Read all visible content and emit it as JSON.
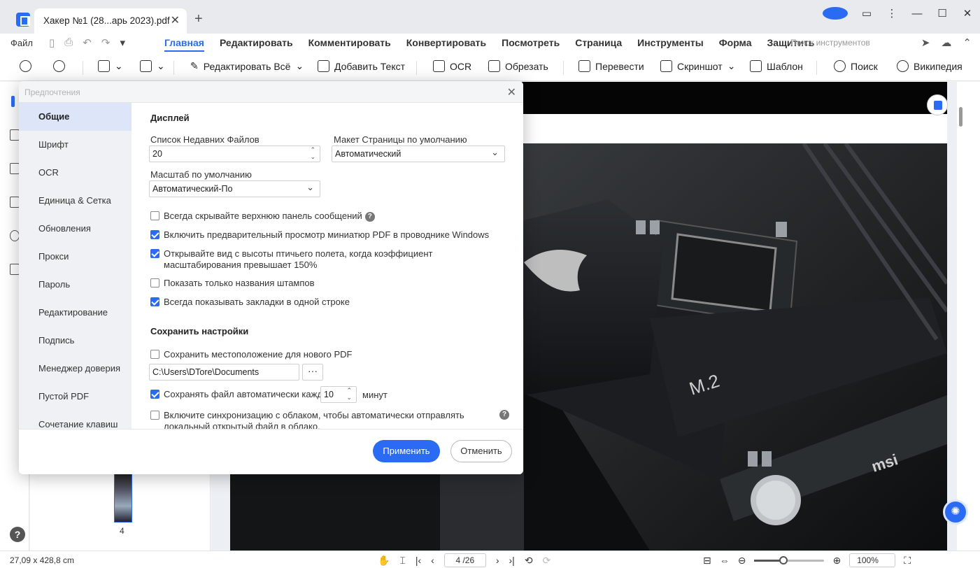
{
  "titlebar": {
    "tab_title": "Хакер №1 (28...арь 2023).pdf",
    "tab_close": "✕",
    "new_tab": "+"
  },
  "menubar": {
    "file": "Файл",
    "items": [
      "Главная",
      "Редактировать",
      "Комментировать",
      "Конвертировать",
      "Посмотреть",
      "Страница",
      "Инструменты",
      "Форма",
      "Защитить"
    ],
    "active": "Главная",
    "tool_search_placeholder": "Поиск инструментов"
  },
  "toolbar": {
    "edit_all": "Редактировать Всё",
    "add_text": "Добавить Текст",
    "ocr": "OCR",
    "crop": "Обрезать",
    "translate": "Перевести",
    "screenshot": "Скриншот",
    "template": "Шаблон",
    "search": "Поиск",
    "wikipedia": "Википедия"
  },
  "thumbnails": {
    "page_label": "4"
  },
  "status": {
    "dimensions": "27,09 x 428,8 cm",
    "page_input": "4 /26",
    "zoom_value": "100%",
    "zoom_level": 0.42
  },
  "dialog": {
    "title": "Предпочтения",
    "close": "✕",
    "sidebar": [
      {
        "label": "Общие",
        "active": true
      },
      {
        "label": "Шрифт"
      },
      {
        "label": "OCR"
      },
      {
        "label": "Единица & Сетка"
      },
      {
        "label": "Обновления"
      },
      {
        "label": "Прокси"
      },
      {
        "label": "Пароль"
      },
      {
        "label": "Редактирование"
      },
      {
        "label": "Подпись"
      },
      {
        "label": "Менеджер доверия"
      },
      {
        "label": "Пустой PDF"
      },
      {
        "label": "Сочетание клавиш"
      }
    ],
    "display": {
      "section": "Дисплей",
      "recent_files_label": "Список Недавних Файлов",
      "recent_files_value": "20",
      "page_layout_label": "Макет Страницы по умолчанию",
      "page_layout_value": "Автоматический",
      "zoom_label": "Масштаб по умолчанию",
      "zoom_value": "Автоматический-По",
      "checkboxes": [
        {
          "label": "Всегда скрывайте верхнюю панель сообщений",
          "checked": false,
          "help": true
        },
        {
          "label": "Включить предварительный просмотр миниатюр PDF в проводнике Windows",
          "checked": true
        },
        {
          "label": "Открывайте вид с высоты птичьего полета, когда коэффициент масштабирования превышает 150%",
          "checked": true
        },
        {
          "label": "Показать только названия штампов",
          "checked": false
        },
        {
          "label": "Всегда показывать закладки в одной строке",
          "checked": true
        }
      ]
    },
    "save": {
      "section": "Сохранить настройки",
      "save_location_label": "Сохранить местоположение для нового PDF",
      "save_location_checked": false,
      "path_value": "C:\\Users\\DTore\\Documents",
      "browse": "···",
      "autosave_label": "Сохранять файл автоматически каждые",
      "autosave_checked": true,
      "autosave_value": "10",
      "autosave_unit": "минут",
      "cloud_label": "Включите синхронизацию с облаком, чтобы автоматически отправлять локальный открытый файл в облако.",
      "cloud_checked": false
    },
    "buttons": {
      "apply": "Применить",
      "cancel": "Отменить"
    }
  },
  "colors": {
    "accent": "#2b6bf3"
  }
}
